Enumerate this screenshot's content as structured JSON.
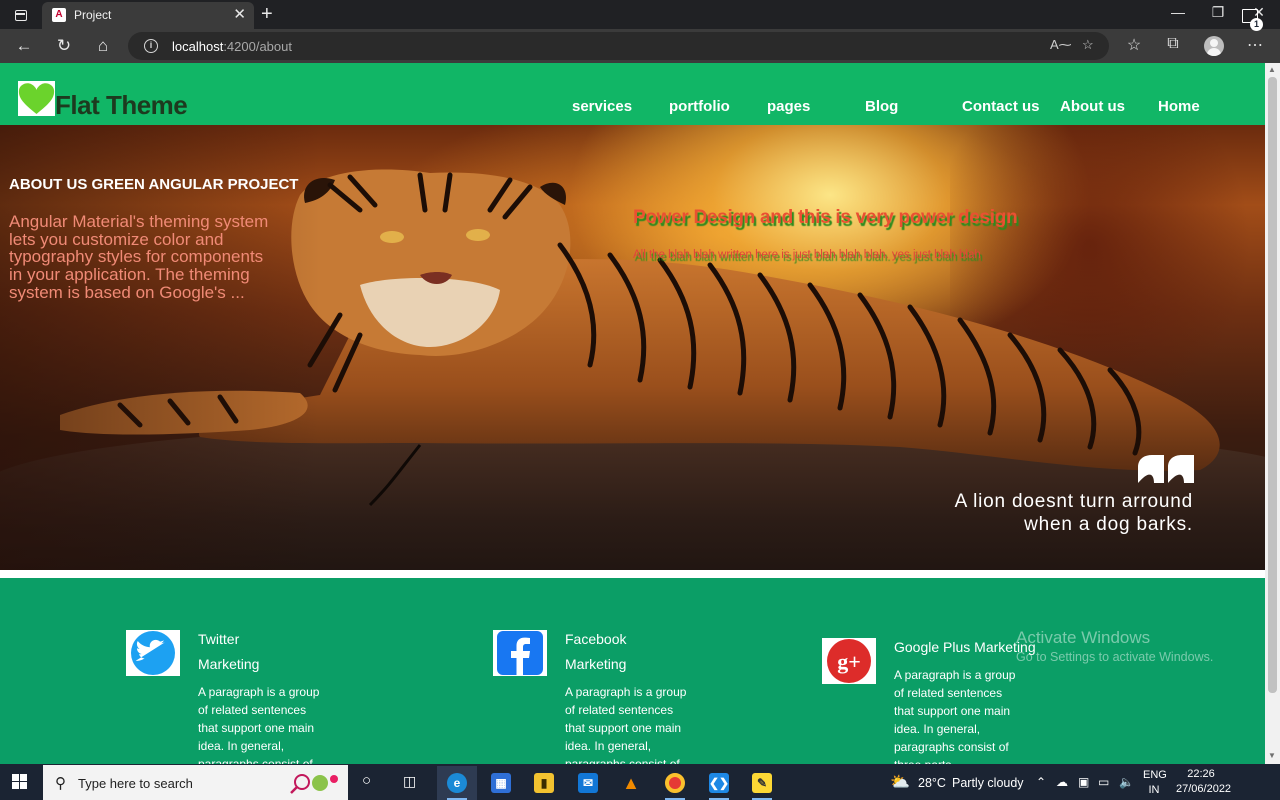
{
  "browser": {
    "tab_title": "Project",
    "tab_favicon_letter": "A",
    "url_host": "localhost",
    "url_path": ":4200/about"
  },
  "site": {
    "logo_text": "Flat Theme",
    "nav": [
      "services",
      "portfolio",
      "pages",
      "Blog",
      "Contact us",
      "About us",
      "Home"
    ]
  },
  "hero": {
    "title": "ABOUT US GREEN ANGULAR PROJECT",
    "text": "Angular Material's theming system lets you customize color and typography styles for components in your application. The theming system is based on Google's ...",
    "power_title": "Power Design and this is very power design",
    "power_text": "All the blah blah written here is just blah blah blah. yes just blah blah",
    "quote_line1": "A lion doesnt turn arround",
    "quote_line2": "when a dog barks."
  },
  "features": [
    {
      "icon": "twitter-icon",
      "title_line1": "Twitter",
      "title_line2": "Marketing",
      "text": "A paragraph is a group of related sentences that support one main idea. In general, paragraphs consist of"
    },
    {
      "icon": "facebook-icon",
      "title_line1": "Facebook",
      "title_line2": "Marketing",
      "text": "A paragraph is a group of related sentences that support one main idea. In general, paragraphs consist of"
    },
    {
      "icon": "google-plus-icon",
      "title_line1": "Google Plus Marketing",
      "title_line2": "",
      "text": "A paragraph is a group of related sentences that support one main idea. In general, paragraphs consist of three parts"
    }
  ],
  "watermark": {
    "title": "Activate Windows",
    "subtitle": "Go to Settings to activate Windows."
  },
  "taskbar": {
    "search_placeholder": "Type here to search",
    "weather_temp": "28°C",
    "weather_text": "Partly cloudy",
    "lang_line1": "ENG",
    "lang_line2": "IN",
    "time": "22:26",
    "date": "27/06/2022",
    "notification_count": "1"
  },
  "colors": {
    "header_green": "#11b666",
    "section_green": "#0b9e66",
    "hero_text_salmon": "#f08a76",
    "power_red": "#ea5032"
  }
}
